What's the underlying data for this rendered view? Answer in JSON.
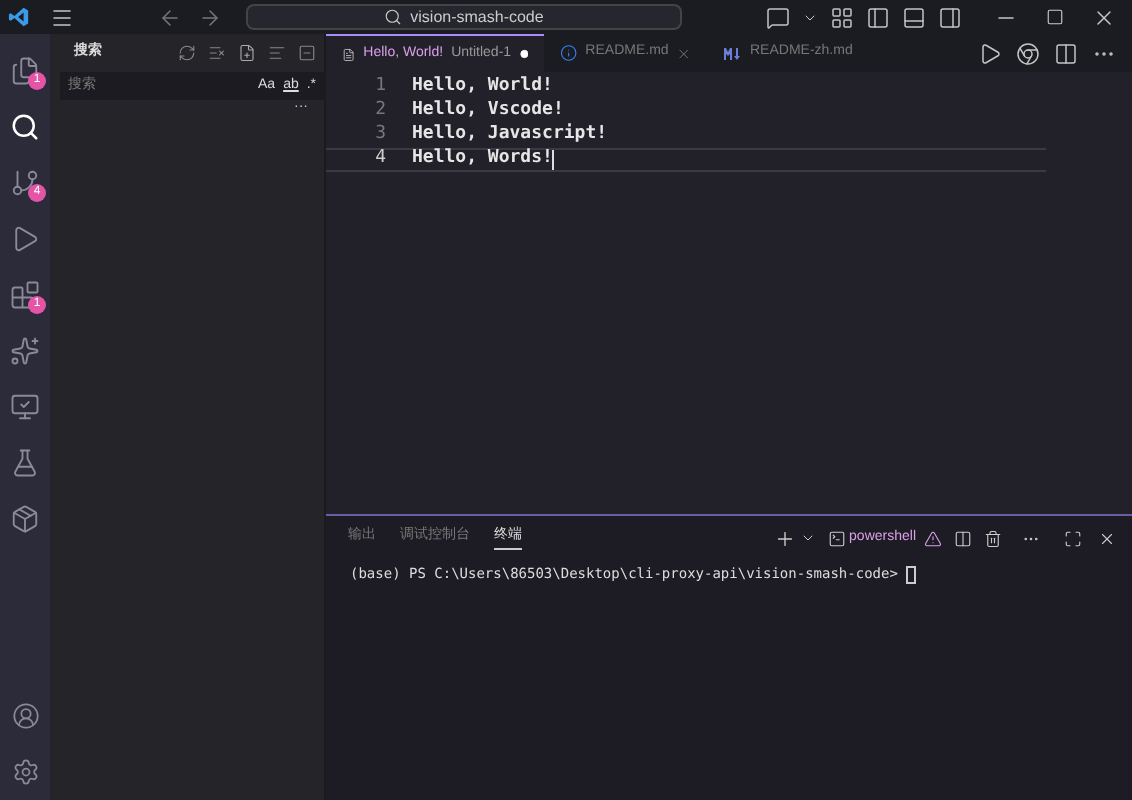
{
  "title_bar": {
    "search": "vision-smash-code"
  },
  "activity_bar": [
    {
      "kind": "explorer",
      "badge": "1",
      "selected": false
    },
    {
      "kind": "search",
      "selected": true
    },
    {
      "kind": "source-control",
      "badge": "4",
      "selected": false
    },
    {
      "kind": "run",
      "selected": false
    },
    {
      "kind": "extensions",
      "badge": "1",
      "selected": false
    },
    {
      "kind": "ai",
      "selected": false
    },
    {
      "kind": "remote",
      "selected": false
    },
    {
      "kind": "testing",
      "selected": false
    },
    {
      "kind": "package",
      "selected": false
    }
  ],
  "sidebar": {
    "title": "搜索",
    "search": {
      "placeholder": "搜索",
      "toggles": [
        "Aa",
        "ab",
        ".*"
      ]
    },
    "more": "···"
  },
  "tabs": [
    {
      "label": "Hello, World!",
      "description": "Untitled-1",
      "modified": true,
      "kind": "file",
      "selected": true
    },
    {
      "label": "README.md",
      "modified": false,
      "kind": "info",
      "selected": false
    },
    {
      "label": "README-zh.md",
      "modified": false,
      "kind": "markdown",
      "selected": false
    }
  ],
  "editor": {
    "lines": [
      {
        "number": "1",
        "text": "Hello, World!"
      },
      {
        "number": "2",
        "text": "Hello, Vscode!"
      },
      {
        "number": "3",
        "text": "Hello, Javascript!"
      },
      {
        "number": "4",
        "text": "Hello, Words!"
      }
    ]
  },
  "panel": {
    "tabs": [
      {
        "label": "输出",
        "selected": false
      },
      {
        "label": "调试控制台",
        "selected": false
      },
      {
        "label": "终端",
        "selected": true
      }
    ],
    "shell": "powershell",
    "terminal_line": "(base) PS C:\\Users\\86503\\Desktop\\cli-proxy-api\\vision-smash-code> "
  }
}
